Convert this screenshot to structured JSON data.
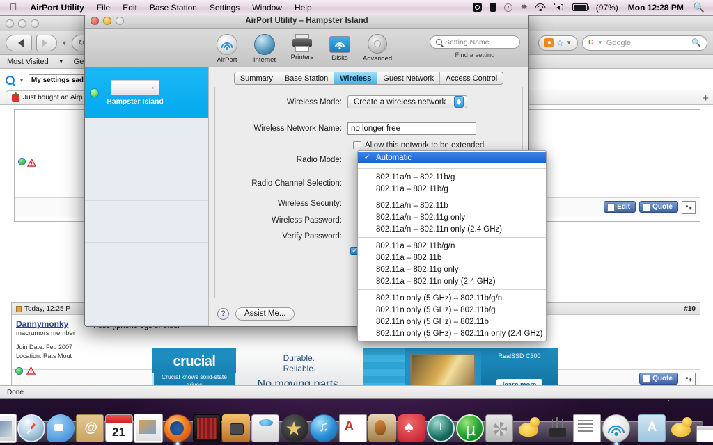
{
  "menubar": {
    "apple_icon": "apple-logo",
    "items": [
      {
        "label": "AirPort Utility",
        "bold": true
      },
      {
        "label": "File",
        "bold": false
      },
      {
        "label": "Edit",
        "bold": false
      },
      {
        "label": "Base Station",
        "bold": false
      },
      {
        "label": "Settings",
        "bold": false
      },
      {
        "label": "Window",
        "bold": false
      },
      {
        "label": "Help",
        "bold": false
      }
    ],
    "status": {
      "battery_percent": "(97%)",
      "clock": "Mon 12:28 PM",
      "icons": [
        "skype-icon",
        "phone-icon",
        "clock-icon",
        "bluetooth-icon",
        "wifi-icon",
        "volume-icon",
        "battery-icon",
        "spotlight-search-icon"
      ]
    }
  },
  "browser": {
    "bookmarks": [
      "Most Visited",
      "Getting"
    ],
    "search_value": "My settings sad",
    "google_placeholder": "Google",
    "tab_label": "Just bought an Airp",
    "status": "Done",
    "post_top": {
      "online_icon": "online-status-dot",
      "warning_icon": "report-post-icon"
    },
    "post": {
      "date": "Today, 12:25 P",
      "username": "Dannymonky",
      "rank": "macrumors member",
      "join_date": "Join Date: Feb 2007",
      "location": "Location: Rats Mout",
      "number": "#10",
      "text": "vices (iphone 3gs or older",
      "edit_label": "Edit",
      "quote_label": "Quote"
    },
    "ad": {
      "brand": "crucial",
      "tagline": "Crucial knows solid-state drives",
      "line1": "Durable.",
      "line2": "Reliable.",
      "headline": "No moving parts.",
      "model": "RealSSD C300",
      "cta": "learn more"
    }
  },
  "airport": {
    "window_title": "AirPort Utility – Hampster Island",
    "toolbar": {
      "items": [
        {
          "label": "AirPort",
          "icon": "airport-icon"
        },
        {
          "label": "Internet",
          "icon": "internet-globe-icon"
        },
        {
          "label": "Printers",
          "icon": "printer-icon"
        },
        {
          "label": "Disks",
          "icon": "disk-icon"
        },
        {
          "label": "Advanced",
          "icon": "gear-icon"
        }
      ],
      "search_placeholder": "Setting Name",
      "search_hint": "Find a setting"
    },
    "sidebar": {
      "base_station_name": "Hampster Island",
      "status": "green"
    },
    "tabs": [
      {
        "label": "Summary",
        "active": false
      },
      {
        "label": "Base Station",
        "active": false
      },
      {
        "label": "Wireless",
        "active": true
      },
      {
        "label": "Guest Network",
        "active": false
      },
      {
        "label": "Access Control",
        "active": false
      }
    ],
    "form": {
      "wireless_mode_label": "Wireless Mode:",
      "wireless_mode_value": "Create a wireless network",
      "network_name_label": "Wireless Network Name:",
      "network_name_value": "no longer free",
      "allow_extend_label": "Allow this network to be extended",
      "allow_extend_checked": false,
      "radio_mode_label": "Radio Mode:",
      "radio_channel_label": "Radio Channel Selection:",
      "wireless_security_label": "Wireless Security:",
      "wireless_password_label": "Wireless Password:",
      "verify_password_label": "Verify Password:",
      "remember_checked": true
    },
    "footer": {
      "help_label": "?",
      "assist_label": "Assist Me..."
    },
    "radio_mode_menu": {
      "selected": "Automatic",
      "groups": [
        [
          "Automatic"
        ],
        [
          "802.11a/n – 802.11b/g",
          "802.11a – 802.11b/g"
        ],
        [
          "802.11a/n – 802.11b",
          "802.11a/n – 802.11g only",
          "802.11a/n – 802.11n only (2.4 GHz)"
        ],
        [
          "802.11a – 802.11b/g/n",
          "802.11a – 802.11b",
          "802.11a – 802.11g only",
          "802.11a – 802.11n only (2.4 GHz)"
        ],
        [
          "802.11n only (5 GHz) – 802.11b/g/n",
          "802.11n only (5 GHz) – 802.11b/g",
          "802.11n only (5 GHz) – 802.11b",
          "802.11n only (5 GHz) – 802.11n only (2.4 GHz)"
        ]
      ]
    }
  },
  "dock": {
    "items": [
      {
        "name": "finder",
        "cls": "finder"
      },
      {
        "name": "dashboard",
        "cls": "dashb"
      },
      {
        "name": "preview",
        "cls": "preview"
      },
      {
        "name": "safari",
        "cls": "safari"
      },
      {
        "name": "ichat",
        "cls": "ichat"
      },
      {
        "name": "address-book",
        "cls": "addrbook"
      },
      {
        "name": "ical",
        "cls": "ical",
        "day": "21"
      },
      {
        "name": "iphoto",
        "cls": "iphoto"
      },
      {
        "name": "firefox",
        "cls": "firefox",
        "running": true
      },
      {
        "name": "front-row",
        "cls": "frontrow"
      },
      {
        "name": "image-capture",
        "cls": "imgcap"
      },
      {
        "name": "toast",
        "cls": "toast"
      },
      {
        "name": "imovie",
        "cls": "imovie"
      },
      {
        "name": "itunes",
        "cls": "itunes"
      },
      {
        "name": "appleworks",
        "cls": "appleworks"
      },
      {
        "name": "garageband",
        "cls": "garage"
      },
      {
        "name": "pokerstars",
        "cls": "pokerstars"
      },
      {
        "name": "time-machine",
        "cls": "timem"
      },
      {
        "name": "utorrent",
        "cls": "utorrent"
      },
      {
        "name": "system-preferences",
        "cls": "sysprefs"
      },
      {
        "name": "cyberduck",
        "cls": "duck"
      },
      {
        "name": "xcode",
        "cls": "xcode"
      },
      {
        "name": "textedit",
        "cls": "textedit"
      },
      {
        "name": "airport-utility",
        "cls": "apu",
        "running": true
      }
    ],
    "right_items": [
      {
        "name": "applications-folder",
        "cls": "appfolder"
      },
      {
        "name": "cyberduck-downloads",
        "cls": "duck"
      },
      {
        "name": "minimized-window-1",
        "cls": "winmini"
      },
      {
        "name": "minimized-window-2",
        "cls": "winmini"
      },
      {
        "name": "minimized-window-3",
        "cls": "winmini"
      },
      {
        "name": "trash",
        "cls": "trash"
      }
    ]
  }
}
